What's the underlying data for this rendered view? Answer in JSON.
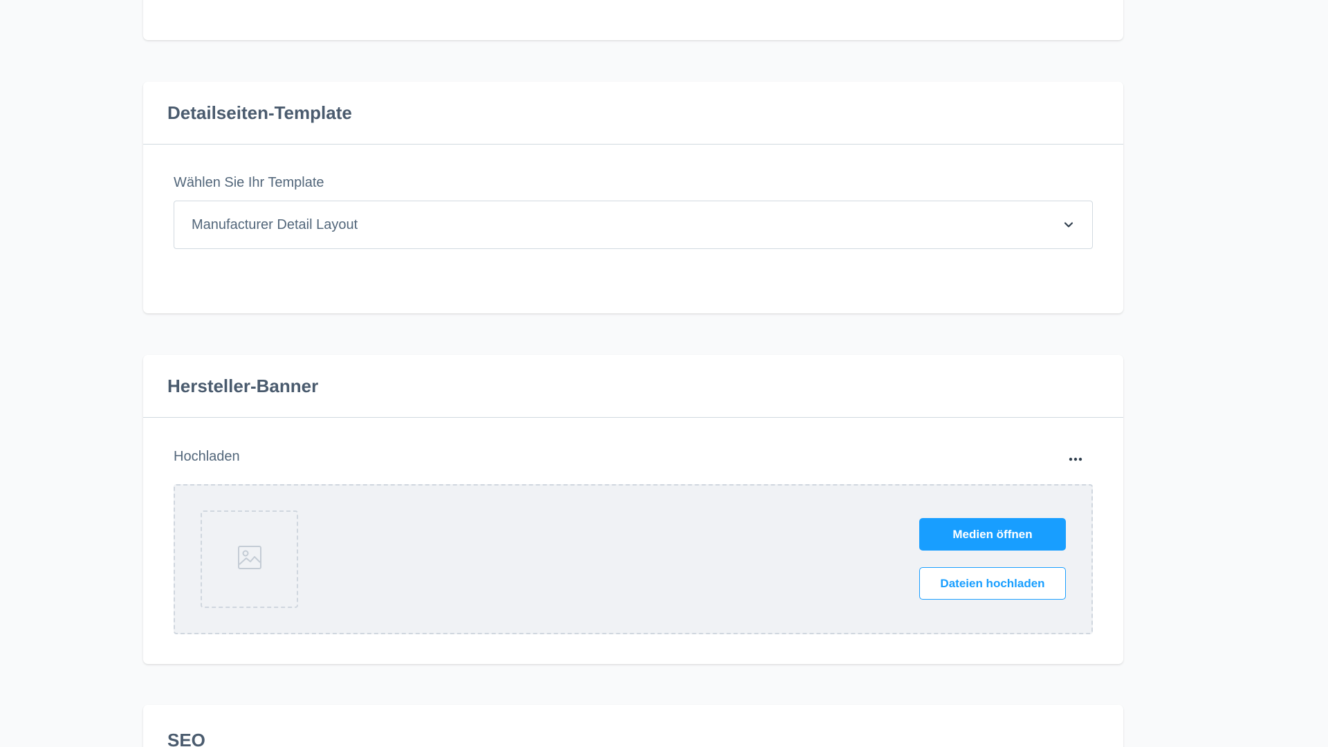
{
  "template_card": {
    "title": "Detailseiten-Template",
    "field_label": "Wählen Sie Ihr Template",
    "selected_value": "Manufacturer Detail Layout"
  },
  "banner_card": {
    "title": "Hersteller-Banner",
    "upload_label": "Hochladen",
    "open_media_label": "Medien öffnen",
    "upload_files_label": "Dateien hochladen"
  },
  "seo_card": {
    "title": "SEO"
  },
  "colors": {
    "accent": "#189eff",
    "background": "#f9fafb",
    "card": "#ffffff",
    "text": "#52667a"
  },
  "icons": {
    "select_toggle": "chevron-down-icon",
    "context_menu": "more-horizontal-icon",
    "preview_placeholder": "image-placeholder-icon"
  }
}
